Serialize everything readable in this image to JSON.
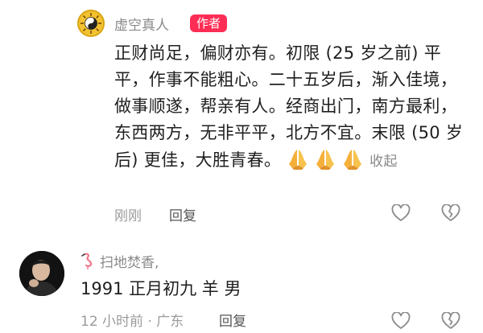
{
  "comment1": {
    "username": "虚空真人",
    "author_badge": "作者",
    "text": "正财尚足，偏财亦有。初限 (25 岁之前) 平平，作事不能粗心。二十五岁后，渐入佳境，做事顺遂，帮亲有人。经商出门，南方最利，东西两方，无非平平，北方不宜。末限 (50 岁后) 更佳，大胜青春。",
    "emojis": [
      "pray-icon",
      "pray-icon",
      "pray-icon"
    ],
    "collapse_label": "收起",
    "time": "刚刚",
    "reply_label": "回复",
    "avatar_icon": "yin-yang-bagua-icon"
  },
  "comment2": {
    "username": "扫地焚香,",
    "name_icon": "flamingo-icon",
    "text": "1991 正月初九 羊 男",
    "meta": "12 小时前 · 广东",
    "reply_label": "回复"
  },
  "colors": {
    "author_badge_bg": "#ff2d55",
    "secondary_text": "#8a8a8a",
    "primary_text": "#1f1f1f"
  }
}
